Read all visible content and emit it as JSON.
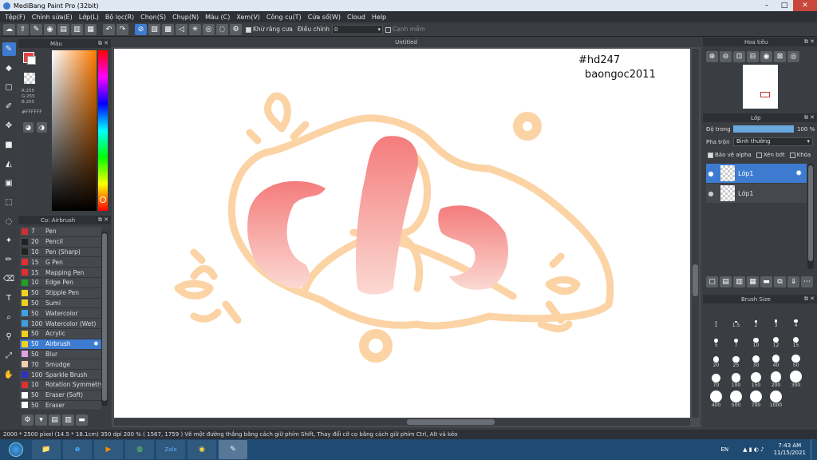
{
  "window": {
    "title": "MediBang Paint Pro (32bit)"
  },
  "menu": [
    "Tệp(F)",
    "Chỉnh sửa(E)",
    "Lớp(L)",
    "Bộ lọc(R)",
    "Chọn(S)",
    "Chụp(N)",
    "Màu (C)",
    "Xem(V)",
    "Công cụ(T)",
    "Cửa sổ(W)",
    "Cloud",
    "Help"
  ],
  "toolbar": {
    "antialias_label": "Khử răng cưa",
    "correction_label": "Điều chỉnh",
    "correction_value": "0",
    "snap_label": "Cạnh mềm"
  },
  "color_panel": {
    "title": "Màu",
    "r": "R:255",
    "g": "G:255",
    "b": "B:255",
    "hex": "#FFFFFF"
  },
  "brush_panel": {
    "title": "Cọ: Airbrush",
    "items": [
      {
        "size": "7",
        "name": "Pen",
        "color": "#d03030"
      },
      {
        "size": "20",
        "name": "Pencil",
        "color": "#222222"
      },
      {
        "size": "10",
        "name": "Pen (Sharp)",
        "color": "#222222"
      },
      {
        "size": "15",
        "name": "G Pen",
        "color": "#e03030"
      },
      {
        "size": "15",
        "name": "Mapping Pen",
        "color": "#e03030"
      },
      {
        "size": "10",
        "name": "Edge Pen",
        "color": "#20a020"
      },
      {
        "size": "50",
        "name": "Stipple Pen",
        "color": "#f0d020"
      },
      {
        "size": "50",
        "name": "Sumi",
        "color": "#f0d020"
      },
      {
        "size": "50",
        "name": "Watercolor",
        "color": "#40a0e0"
      },
      {
        "size": "100",
        "name": "Watercolor (Wet)",
        "color": "#40a0e0"
      },
      {
        "size": "50",
        "name": "Acrylic",
        "color": "#f0d020"
      },
      {
        "size": "50",
        "name": "Airbrush",
        "color": "#f0d020"
      },
      {
        "size": "50",
        "name": "Blur",
        "color": "#e0a0e0"
      },
      {
        "size": "70",
        "name": "Smudge",
        "color": "#f0d0b0"
      },
      {
        "size": "100",
        "name": "Sparkle Brush",
        "color": "#3030c0"
      },
      {
        "size": "10",
        "name": "Rotation Symmetry",
        "color": "#e03030"
      },
      {
        "size": "50",
        "name": "Eraser (Soft)",
        "color": "#ffffff"
      },
      {
        "size": "50",
        "name": "Eraser",
        "color": "#ffffff"
      }
    ],
    "selected_index": 11
  },
  "canvas": {
    "tab": "Untitled",
    "text1": "#hd247",
    "text2": "baongoc2011"
  },
  "navigator": {
    "title": "Hoa tiêu"
  },
  "layers": {
    "title": "Lớp",
    "opacity_label": "Độ trong",
    "opacity_value": "100 %",
    "opacity_fraction": 1.0,
    "blend_label": "Pha trộn",
    "blend_value": "Bình thường",
    "protect_alpha": "Bảo vệ alpha",
    "clipping": "Xén bớt",
    "lock": "Khóa",
    "items": [
      {
        "name": "Lớp1",
        "selected": true
      },
      {
        "name": "Lớp1",
        "selected": false
      }
    ]
  },
  "brush_size": {
    "title": "Brush Size",
    "sizes": [
      "1",
      "1.5",
      "2",
      "3",
      "4",
      "5",
      "7",
      "10",
      "12",
      "15",
      "20",
      "25",
      "30",
      "40",
      "50",
      "70",
      "100",
      "150",
      "200",
      "300",
      "400",
      "500",
      "700",
      "1000"
    ]
  },
  "status": {
    "text": "2000 * 2500 pixel   (14.5 * 18.1cm)   350 dpi   200 %   ( 1567, 1759 )   Vẽ một đường thẳng bằng cách giữ phím Shift, Thay đổi cỡ cọ bằng cách giữ phím Ctrl, Alt và kéo"
  },
  "taskbar": {
    "lang": "EN",
    "time": "7:43 AM",
    "date": "11/15/2021"
  },
  "colors": {
    "accent": "#3d7bd0",
    "pink": "#f47c7c",
    "peach": "#fbd3a4"
  }
}
